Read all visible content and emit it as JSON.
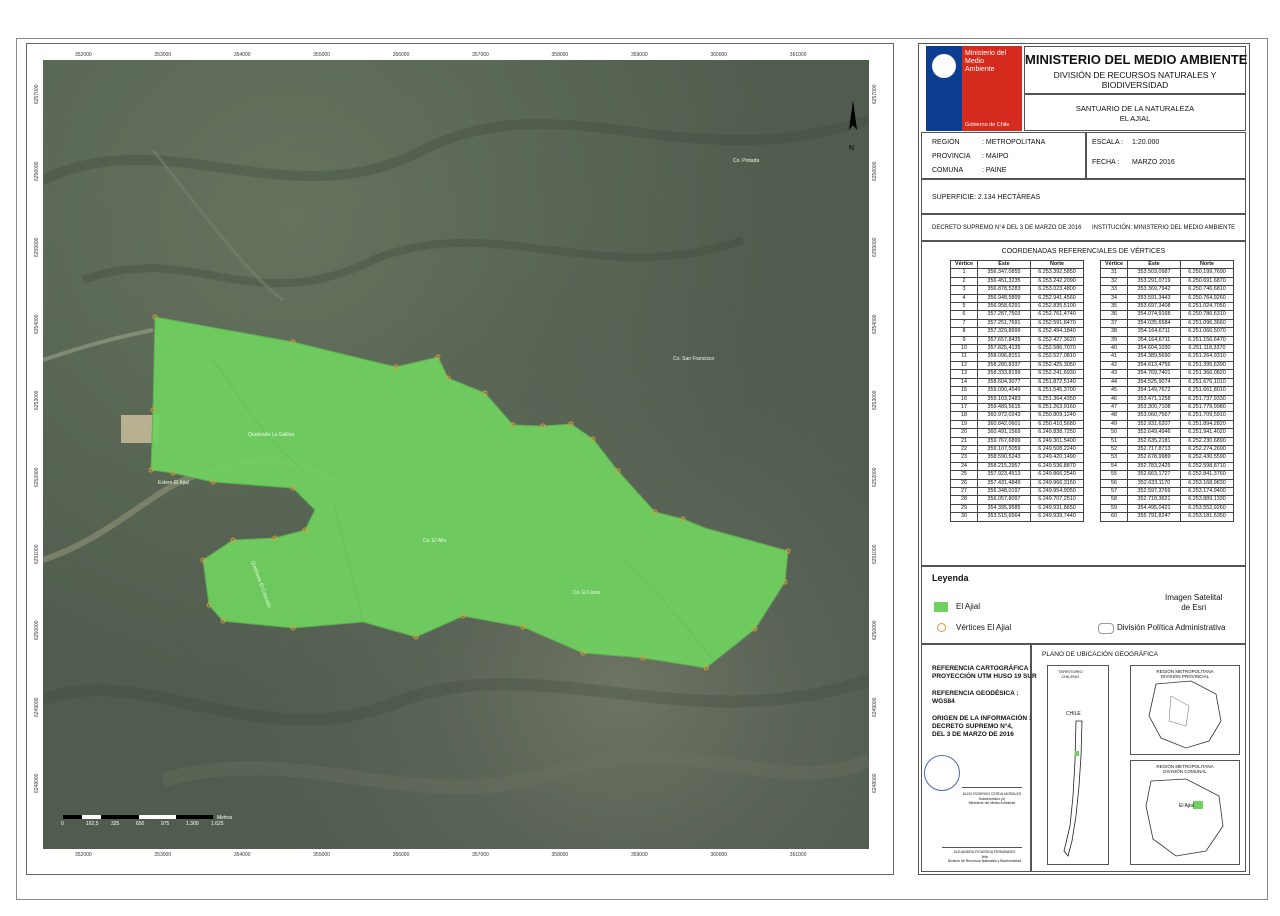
{
  "header": {
    "logo_line1": "Ministerio del",
    "logo_line2": "Medio",
    "logo_line3": "Ambiente",
    "logo_footer": "Gobierno de Chile",
    "ministry": "MINISTERIO DEL MEDIO AMBIENTE",
    "division_line1": "DIVISIÓN DE RECURSOS NATURALES Y",
    "division_line2": "BIODIVERSIDAD",
    "sanctuary_line1": "SANTUARIO DE LA NATURALEZA",
    "sanctuary_line2": "EL AJIAL"
  },
  "info": {
    "region_label": "REGIÓN",
    "region_value": ": METROPOLITANA",
    "provincia_label": "PROVINCIA",
    "provincia_value": ": MAIPO",
    "comuna_label": "COMUNA",
    "comuna_value": ": PAINE",
    "escala_label": "ESCALA :",
    "escala_value": "1:20.000",
    "fecha_label": "FECHA :",
    "fecha_value": "MARZO 2016",
    "superficie": "SUPERFICIE: 2.134 HECTÁREAS",
    "decreto": "DECRETO SUPREMO N°4 DEL 3 DE MARZO DE 2016",
    "institucion": "INSTITUCIÓN: MINISTERIO DEL MEDIO AMBIENTE"
  },
  "vertices": {
    "title": "COORDENADAS REFERENCIALES DE VÉRTICES",
    "headers": [
      "Vértice",
      "Este",
      "Norte"
    ],
    "rows": [
      [
        "1",
        "356.347,0855",
        "6.253.392,5850"
      ],
      [
        "2",
        "356.451,3235",
        "6.253.242,2090"
      ],
      [
        "3",
        "356.878,5283",
        "6.253.023,4800"
      ],
      [
        "4",
        "356.948,5899",
        "6.252.941,4560"
      ],
      [
        "5",
        "356.958,6291",
        "6.252.835,5100"
      ],
      [
        "6",
        "357.287,7503",
        "6.252.761,4740"
      ],
      [
        "7",
        "357.251,7691",
        "6.252.591,8470"
      ],
      [
        "8",
        "357.329,8999",
        "6.252.494,1840"
      ],
      [
        "9",
        "357.657,8435",
        "6.252.427,3620"
      ],
      [
        "10",
        "357.825,4135",
        "6.252.586,7070"
      ],
      [
        "11",
        "358.096,8151",
        "6.252.527,0810"
      ],
      [
        "12",
        "358.280,8337",
        "6.252.425,3050"
      ],
      [
        "13",
        "358.333,8199",
        "6.252.241,6930"
      ],
      [
        "14",
        "358.604,3077",
        "6.251.872,5140"
      ],
      [
        "15",
        "359.090,4549",
        "6.251.545,3700"
      ],
      [
        "16",
        "359.103,2483",
        "6.251.364,4350"
      ],
      [
        "17",
        "359.489,5615",
        "6.251.263,9160"
      ],
      [
        "18",
        "360.972,0243",
        "6.250.809,1240"
      ],
      [
        "19",
        "360.842,0601",
        "6.250.410,5680"
      ],
      [
        "20",
        "360.491,1569",
        "6.249.838,7250"
      ],
      [
        "21",
        "359.767,6899",
        "6.249.301,5400"
      ],
      [
        "22",
        "359.107,5059",
        "6.249.508,2240"
      ],
      [
        "23",
        "358.590,5243",
        "6.249.420,1490"
      ],
      [
        "24",
        "358.215,2957",
        "6.249.536,8870"
      ],
      [
        "25",
        "357.923,4513",
        "6.249.866,2540"
      ],
      [
        "26",
        "357.431,4849",
        "6.249.966,3150"
      ],
      [
        "27",
        "356.348,0197",
        "6.249.954,9050"
      ],
      [
        "28",
        "356.057,8097",
        "6.249.707,2510"
      ],
      [
        "29",
        "354.395,9585",
        "6.249.931,8650"
      ],
      [
        "30",
        "353.515,6564",
        "6.249.939,7440"
      ],
      [
        "31",
        "353.503,0987",
        "6.250.199,7690"
      ],
      [
        "32",
        "353.291,0719",
        "6.250.691,6870"
      ],
      [
        "33",
        "353.369,7942",
        "6.250.746,6810"
      ],
      [
        "34",
        "353.591,3443",
        "6.250.764,9260"
      ],
      [
        "35",
        "353.697,3408",
        "6.251.024,7050"
      ],
      [
        "36",
        "354.074,9168",
        "6.250.786,6310"
      ],
      [
        "37",
        "354.035,6584",
        "6.251.096,3660"
      ],
      [
        "38",
        "354.164,6711",
        "6.251.066,5070"
      ],
      [
        "39",
        "354.164,6711",
        "6.251.156,6470"
      ],
      [
        "40",
        "354.604,1030",
        "6.251.118,3370"
      ],
      [
        "41",
        "354.389,5690",
        "6.251.264,9310"
      ],
      [
        "42",
        "354.613,4756",
        "6.251.395,6390"
      ],
      [
        "43",
        "354.769,7401",
        "6.251.366,0820"
      ],
      [
        "44",
        "354.525,9074",
        "6.251.676,1010"
      ],
      [
        "45",
        "354.149,7672",
        "6.251.661,8010"
      ],
      [
        "46",
        "353.471,1258",
        "6.251.737,9330"
      ],
      [
        "47",
        "353.300,7108",
        "6.251.779,9980"
      ],
      [
        "48",
        "353.060,7567",
        "6.251.709,5910"
      ],
      [
        "49",
        "352.931,6207",
        "6.251.894,2820"
      ],
      [
        "50",
        "352.649,4946",
        "6.251.941,4020"
      ],
      [
        "51",
        "352.635,2181",
        "6.252.230,6890"
      ],
      [
        "52",
        "352.717,8713",
        "6.252.274,2690"
      ],
      [
        "53",
        "352.678,9989",
        "6.252.430,5590"
      ],
      [
        "54",
        "352.783,2425",
        "6.252.598,8710"
      ],
      [
        "55",
        "352.663,1727",
        "6.252.841,3760"
      ],
      [
        "56",
        "352.633,1170",
        "6.253.168,9830"
      ],
      [
        "57",
        "352.597,3769",
        "6.253.174,9400"
      ],
      [
        "58",
        "352.718,3621",
        "6.253.889,1330"
      ],
      [
        "59",
        "354.495,0421",
        "6.253.552,9260"
      ],
      [
        "60",
        "355.791,8247",
        "6.253.181,5350"
      ]
    ]
  },
  "legend": {
    "title": "Leyenda",
    "item_ajial": "El Ajial",
    "item_vertices": "Vértices El Ajial",
    "item_satellite_line1": "Imagen Satelital",
    "item_satellite_line2": "de Esri",
    "item_division": "División Política Administrativa"
  },
  "references": {
    "carto_line1": "REFERENCIA CARTOGRÁFICA :",
    "carto_line2": "PROYECCIÓN UTM HUSO 19 SUR",
    "geod_line1": "REFERENCIA GEODÉSICA :",
    "geod_line2": "WGS84",
    "origin_line1": "ORIGEN DE LA INFORMACIÓN :",
    "origin_line2": "DECRETO SUPREMO N°4,",
    "origin_line3": "DEL 3 DE MARZO DE 2016",
    "sig1_name": "ALDO RODRIGO CERDA MORALES",
    "sig1_role1": "Subsecretario (s)",
    "sig1_role2": "Ministerio del Medio Ambiente",
    "sig2_name": "ALEJANDRA FIGUEROA FERNÁNDEZ",
    "sig2_role1": "Jefa",
    "sig2_role2": "División de Recursos Naturales y Biodiversidad"
  },
  "location": {
    "title": "PLANO DE UBICACIÓN GEOGRÁFICA",
    "territorio_line1": "TERRITORIO",
    "territorio_line2": "CHILENO",
    "chile": "CHILE",
    "provincial_line1": "REGIÓN METROPOLITANA",
    "provincial_line2": "DIVISIÓN PROVINCIAL",
    "comunal_line1": "REGIÓN METROPOLITANA",
    "comunal_line2": "DIVISIÓN COMUNAL",
    "comunal_label": "El Ajial"
  },
  "map": {
    "x_ticks": [
      "352000",
      "353000",
      "354000",
      "355000",
      "356000",
      "357000",
      "358000",
      "359000",
      "360000",
      "361000"
    ],
    "y_ticks": [
      "6257000",
      "6256000",
      "6255000",
      "6254000",
      "6253000",
      "6252000",
      "6251000",
      "6250000",
      "6249000",
      "6248000"
    ],
    "place_labels": {
      "pintada": "Co. Pintada",
      "san_francisco": "Co. San Francisco",
      "gallina": "Quebrada La Gallina",
      "el_alto": "Co. El Alto",
      "el_llano": "Co. El Llano",
      "estero": "Estero El Ajial",
      "el_colorado": "Quebrada El Colorado"
    },
    "scale_label": "Metros",
    "scale_ticks": [
      "0",
      "162,5",
      "325",
      "650",
      "975",
      "1.300",
      "1.625"
    ],
    "north": "N",
    "colors": {
      "polygon": "#70d160",
      "terrain": "#4f6050",
      "vertex": "#e39a3a"
    }
  }
}
